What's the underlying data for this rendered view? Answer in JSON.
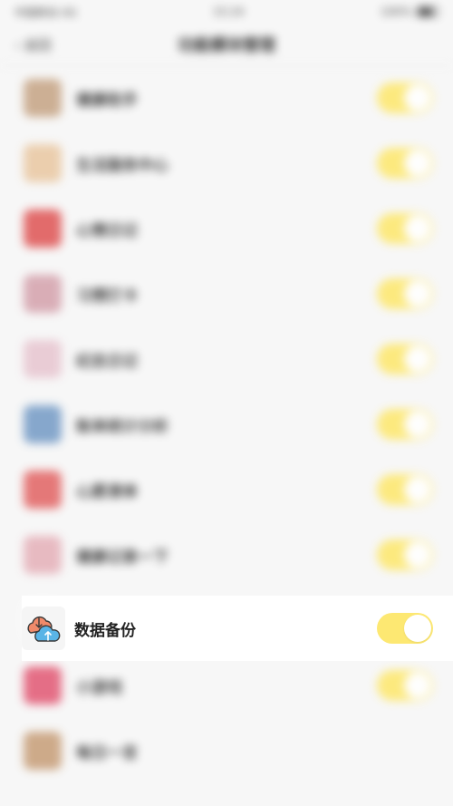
{
  "status_bar": {
    "carrier": "中国移动 4G",
    "time": "15:24",
    "battery": "100%"
  },
  "nav": {
    "back_label": "返回",
    "title": "功能模块管理"
  },
  "modules": [
    {
      "label": "健康助手",
      "icon": "brown-box-icon",
      "color": "#c8a88a",
      "enabled": true
    },
    {
      "label": "生活服务中心",
      "icon": "beige-box-icon",
      "color": "#eacaa6",
      "enabled": true
    },
    {
      "label": "心情日记",
      "icon": "red-heart-icon",
      "color": "#e05c5c",
      "enabled": true
    },
    {
      "label": "习惯打卡",
      "icon": "pink-card-icon",
      "color": "#d6a6b0",
      "enabled": true
    },
    {
      "label": "纪念日记",
      "icon": "pink-note-icon",
      "color": "#e8c8d2",
      "enabled": true
    },
    {
      "label": "账单统计分析",
      "icon": "blue-chart-icon",
      "color": "#7a9fc8",
      "enabled": true
    },
    {
      "label": "心愿清单",
      "icon": "red-list-icon",
      "color": "#e36b6b",
      "enabled": true
    },
    {
      "label": "健康记录一下",
      "icon": "pink-record-icon",
      "color": "#e6b4bc",
      "enabled": true
    },
    {
      "label": "",
      "icon": "placeholder",
      "color": "#ffffff",
      "enabled": true
    },
    {
      "label": "小游戏",
      "icon": "colorful-game-icon",
      "color": "#e3607a",
      "enabled": true
    },
    {
      "label": "每日一言",
      "icon": "tan-quote-icon",
      "color": "#c9a27e",
      "enabled": false
    }
  ],
  "focused_module": {
    "label": "数据备份",
    "icon": "cloud-backup-icon",
    "enabled": true
  },
  "colors": {
    "toggle_on": "#fde872",
    "toggle_knob": "#ffffff",
    "cloud_orange": "#f08a6a",
    "cloud_blue": "#5ab4e6"
  }
}
